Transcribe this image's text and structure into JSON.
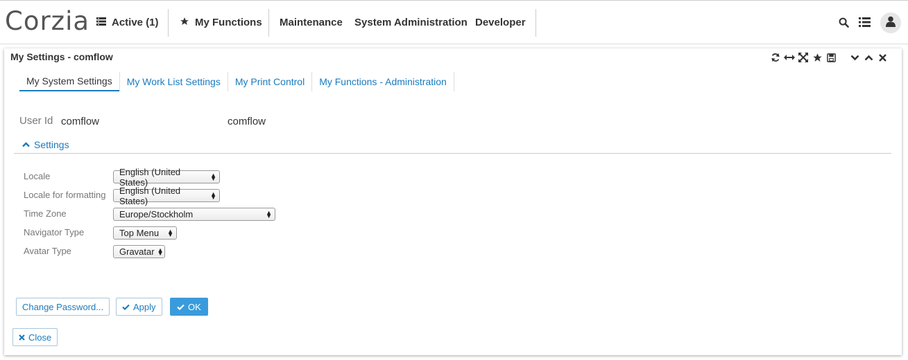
{
  "app": {
    "logo": "Corzia",
    "nav": {
      "active": "Active (1)",
      "my_functions": "My Functions",
      "maintenance": "Maintenance",
      "system_administration": "System Administration",
      "developer": "Developer"
    }
  },
  "panel": {
    "title": "My Settings - comflow",
    "tabs": [
      {
        "label": "My System Settings"
      },
      {
        "label": "My Work List Settings"
      },
      {
        "label": "My Print Control"
      },
      {
        "label": "My Functions - Administration"
      }
    ],
    "user": {
      "label": "User Id",
      "value": "comflow",
      "value_display": "comflow"
    },
    "settings": {
      "header": "Settings",
      "locale": {
        "label": "Locale",
        "value": "English (United States)"
      },
      "locale_formatting": {
        "label": "Locale for formatting",
        "value": "English (United States)"
      },
      "time_zone": {
        "label": "Time Zone",
        "value": "Europe/Stockholm"
      },
      "navigator_type": {
        "label": "Navigator Type",
        "value": "Top Menu"
      },
      "avatar_type": {
        "label": "Avatar Type",
        "value": "Gravatar"
      }
    },
    "buttons": {
      "change_password": "Change Password...",
      "apply": "Apply",
      "ok": "OK",
      "close": "Close"
    }
  },
  "colors": {
    "accent": "#1a7bbf",
    "primary_button": "#3a9bdc"
  },
  "icons": {
    "active": "list-icon",
    "my_functions": "star-icon",
    "search": "search-icon",
    "list": "list-view-icon",
    "avatar": "user-icon"
  }
}
